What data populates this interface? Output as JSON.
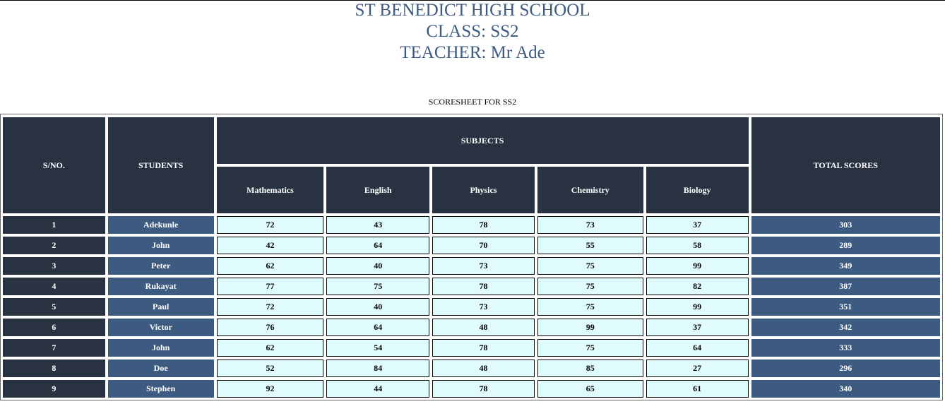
{
  "header": {
    "school": "ST BENEDICT HIGH SCHOOL",
    "class_line": "CLASS: SS2",
    "teacher_line": "TEACHER: Mr Ade"
  },
  "caption": "SCORESHEET FOR SS2",
  "table": {
    "col_sn": "S/NO.",
    "col_students": "STUDENTS",
    "col_subjects": "SUBJECTS",
    "col_total": "TOTAL SCORES",
    "subjects": [
      "Mathematics",
      "English",
      "Physics",
      "Chemistry",
      "Biology"
    ],
    "rows": [
      {
        "sn": "1",
        "name": "Adekunle",
        "scores": [
          "72",
          "43",
          "78",
          "73",
          "37"
        ],
        "total": "303"
      },
      {
        "sn": "2",
        "name": "John",
        "scores": [
          "42",
          "64",
          "70",
          "55",
          "58"
        ],
        "total": "289"
      },
      {
        "sn": "3",
        "name": "Peter",
        "scores": [
          "62",
          "40",
          "73",
          "75",
          "99"
        ],
        "total": "349"
      },
      {
        "sn": "4",
        "name": "Rukayat",
        "scores": [
          "77",
          "75",
          "78",
          "75",
          "82"
        ],
        "total": "387"
      },
      {
        "sn": "5",
        "name": "Paul",
        "scores": [
          "72",
          "40",
          "73",
          "75",
          "99"
        ],
        "total": "351"
      },
      {
        "sn": "6",
        "name": "Victor",
        "scores": [
          "76",
          "64",
          "48",
          "99",
          "37"
        ],
        "total": "342"
      },
      {
        "sn": "7",
        "name": "John",
        "scores": [
          "62",
          "54",
          "78",
          "75",
          "64"
        ],
        "total": "333"
      },
      {
        "sn": "8",
        "name": "Doe",
        "scores": [
          "52",
          "84",
          "48",
          "85",
          "27"
        ],
        "total": "296"
      },
      {
        "sn": "9",
        "name": "Stephen",
        "scores": [
          "92",
          "44",
          "78",
          "65",
          "61"
        ],
        "total": "340"
      }
    ]
  }
}
